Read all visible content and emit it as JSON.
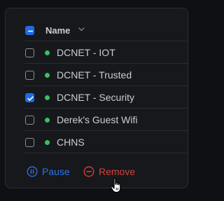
{
  "table": {
    "header": {
      "column_label": "Name",
      "select_all_checked": true
    },
    "rows": [
      {
        "name": "DCNET - IOT",
        "checked": false,
        "status_color": "#39c25a"
      },
      {
        "name": "DCNET - Trusted",
        "checked": false,
        "status_color": "#39c25a"
      },
      {
        "name": "DCNET - Security",
        "checked": true,
        "status_color": "#39c25a"
      },
      {
        "name": "Derek's Guest Wifi",
        "checked": false,
        "status_color": "#39c25a"
      },
      {
        "name": "CHNS",
        "checked": false,
        "status_color": "#39c25a"
      }
    ]
  },
  "actions": {
    "pause_label": "Pause",
    "remove_label": "Remove"
  },
  "icons": {
    "sort": "chevron-down-icon",
    "pause": "pause-circle-icon",
    "remove": "minus-circle-icon",
    "cursor": "hand-pointer-icon"
  },
  "colors": {
    "accent": "#1d6ce0",
    "danger": "#d9403a",
    "status_online": "#39c25a"
  }
}
